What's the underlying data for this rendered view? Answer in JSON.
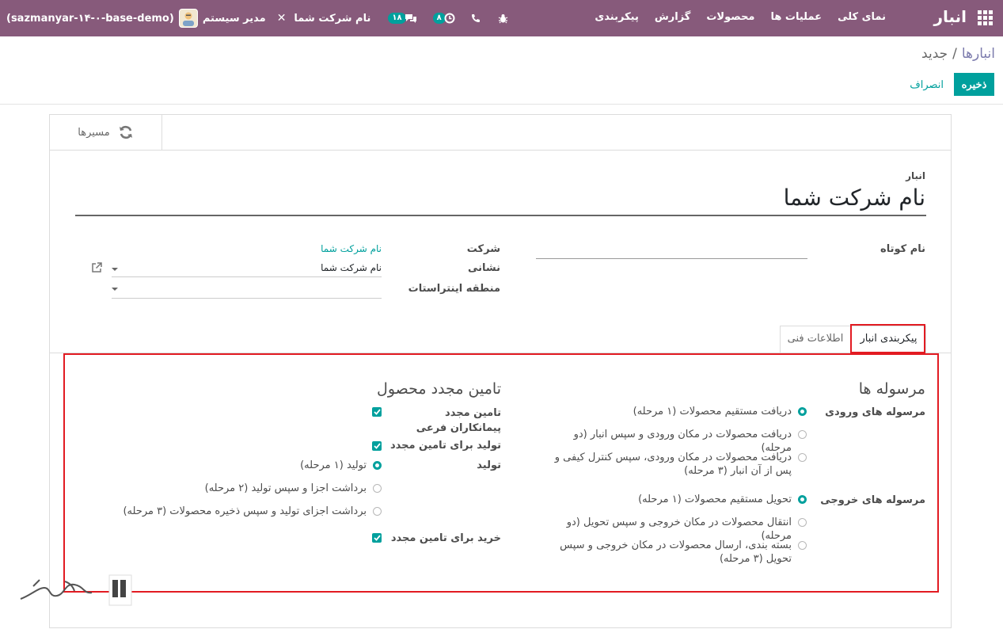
{
  "navbar": {
    "brand": "انبار",
    "menu": [
      "نمای کلی",
      "عملیات ها",
      "محصولات",
      "گزارش",
      "پیکربندی"
    ],
    "company": "نام شرکت شما",
    "user": "مدیر سیستم",
    "db": "(sazmanyar-۱۴-۰-base-demo)",
    "messages_count": "۱۸",
    "activities_count": "۸"
  },
  "breadcrumb": {
    "parent": "انبارها",
    "separator": "/",
    "current": "جدید"
  },
  "actions": {
    "save": "ذخیره",
    "discard": "انصراف"
  },
  "stat_button": {
    "label": "مسیرها"
  },
  "form": {
    "title_label": "انبار",
    "title_value": "نام شرکت شما",
    "short_name_label": "نام کوتاه",
    "company_label": "شرکت",
    "company_value": "نام شرکت شما",
    "address_label": "نشانی",
    "address_value": "نام شرکت شما",
    "region_label": "منطقه اینتراستات"
  },
  "tabs": {
    "config": "پیکربندی انبار",
    "technical": "اطلاعات فنی"
  },
  "shipments": {
    "title": "مرسوله ها",
    "incoming_label": "مرسوله های ورودی",
    "incoming_options": [
      "دریافت مستقیم محصولات (۱ مرحله)",
      "دریافت محصولات در مکان ورودی و سپس انبار (دو مرحله)",
      "دریافت محصولات در مکان ورودی، سپس کنترل کیفی و پس از آن انبار (۳ مرحله)"
    ],
    "outgoing_label": "مرسوله های خروجی",
    "outgoing_options": [
      "تحویل مستقیم محصولات (۱ مرحله)",
      "انتقال محصولات در مکان خروجی و سپس تحویل (دو مرحله)",
      "بسته بندی، ارسال محصولات در مکان خروجی و سپس تحویل (۳ مرحله)"
    ]
  },
  "resupply": {
    "title": "تامین مجدد محصول",
    "subcontract_label": "تامین مجدد پیمانکاران فرعی",
    "manufacture_resupply_label": "تولید برای تامین مجدد",
    "manufacture_label": "تولید",
    "manufacture_options": [
      "تولید (۱ مرحله)",
      "برداشت اجزا و سپس تولید (۲ مرحله)",
      "برداشت اجزای تولید و سپس ذخیره محصولات (۳ مرحله)"
    ],
    "buy_label": "خرید برای تامین مجدد"
  },
  "colors": {
    "navbar": "#875a7b",
    "accent": "#00a09d",
    "highlight": "#e21b22"
  }
}
